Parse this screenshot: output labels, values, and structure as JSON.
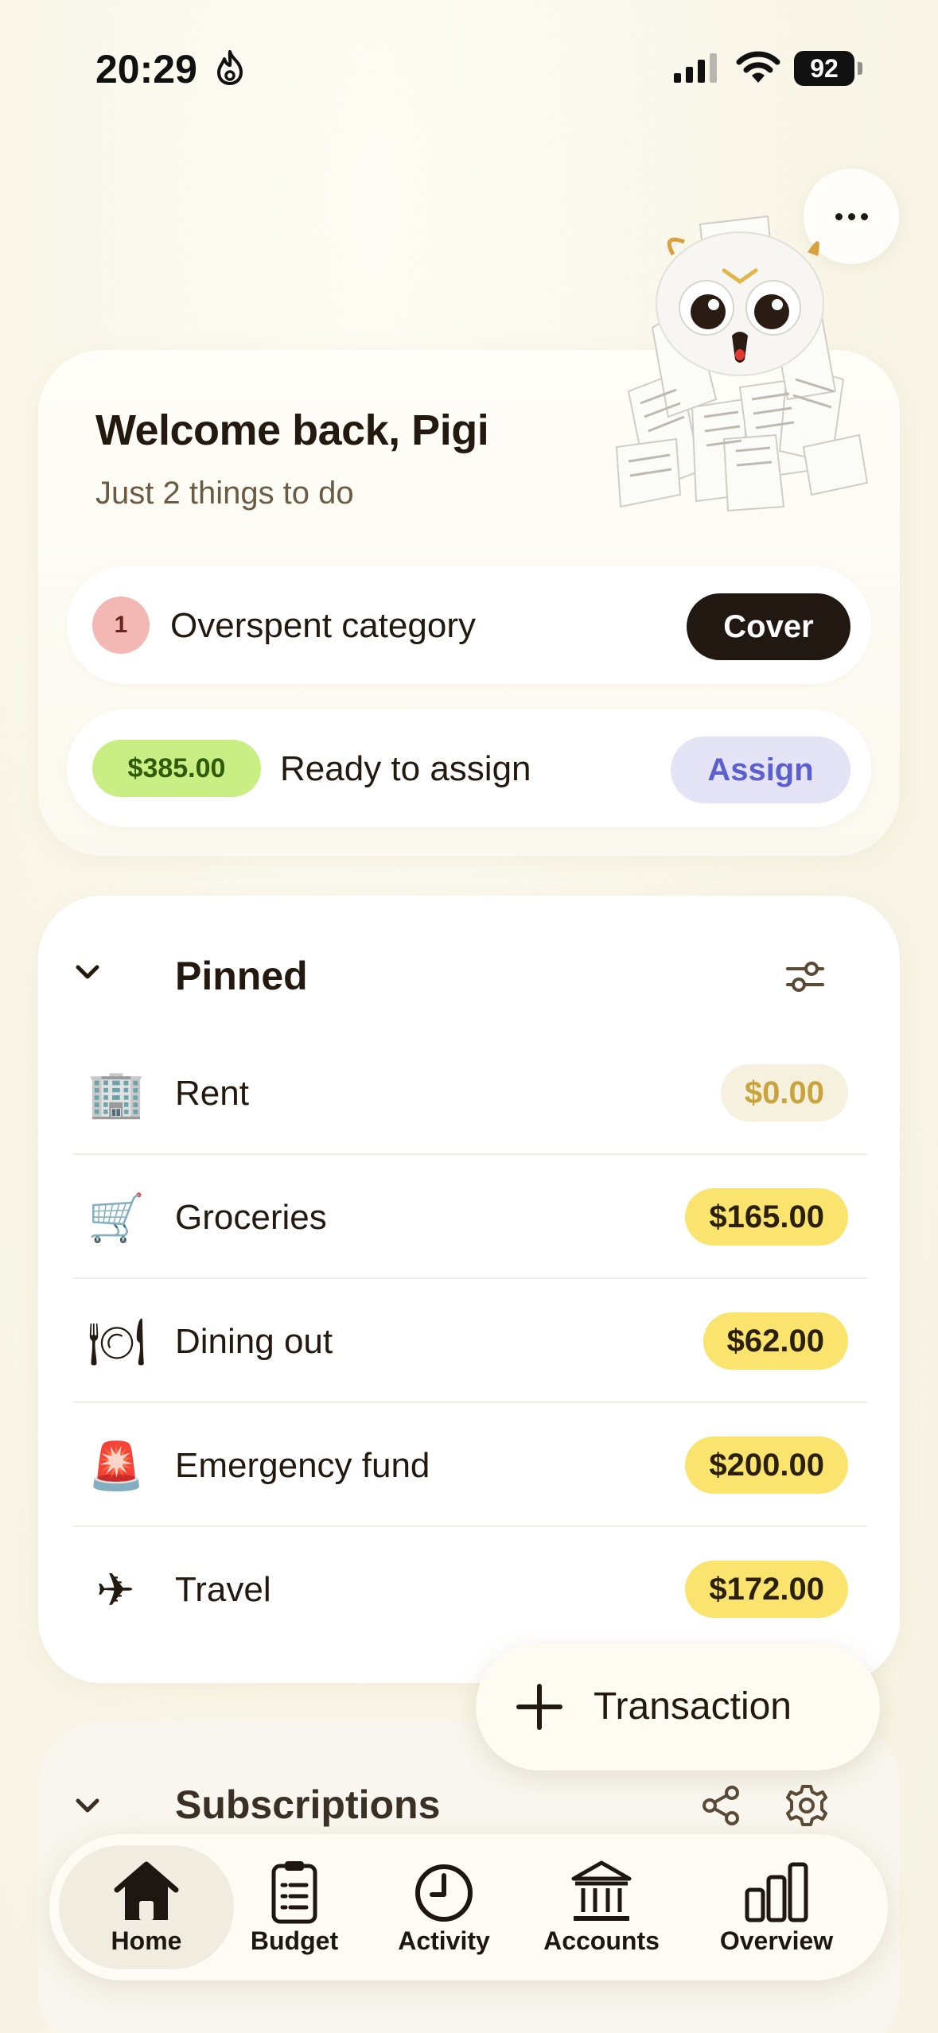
{
  "status_bar": {
    "time": "20:29",
    "battery": "92"
  },
  "welcome": {
    "title": "Welcome back, Pigi",
    "subtitle": "Just 2 things to do"
  },
  "tasks": {
    "overspent": {
      "count": "1",
      "label": "Overspent category",
      "action": "Cover"
    },
    "ready": {
      "amount": "$385.00",
      "label": "Ready to assign",
      "action": "Assign"
    }
  },
  "pinned": {
    "title": "Pinned",
    "items": [
      {
        "icon": "office-building-icon",
        "emoji": "🏢",
        "name": "Rent",
        "amount": "$0.00"
      },
      {
        "icon": "shopping-cart-icon",
        "emoji": "🛒",
        "name": "Groceries",
        "amount": "$165.00"
      },
      {
        "icon": "plate-cutlery-icon",
        "emoji": "🍽",
        "name": "Dining out",
        "amount": "$62.00"
      },
      {
        "icon": "siren-icon",
        "emoji": "🚨",
        "name": "Emergency fund",
        "amount": "$200.00"
      },
      {
        "icon": "airplane-icon",
        "emoji": "✈",
        "name": "Travel",
        "amount": "$172.00"
      }
    ]
  },
  "fab": {
    "label": "Transaction"
  },
  "subscriptions": {
    "title": "Subscriptions"
  },
  "tabs": [
    {
      "label": "Home",
      "icon": "house-icon"
    },
    {
      "label": "Budget",
      "icon": "clipboard-icon"
    },
    {
      "label": "Activity",
      "icon": "clock-icon"
    },
    {
      "label": "Accounts",
      "icon": "bank-icon"
    },
    {
      "label": "Overview",
      "icon": "bar-chart-icon"
    }
  ],
  "colors": {
    "accent_dark": "#221812",
    "assign_blue": "#5c5fce",
    "ready_green": "#c8ee84",
    "amount_yellow": "#fbe46d",
    "overspent_pink": "#f4b8b4"
  }
}
